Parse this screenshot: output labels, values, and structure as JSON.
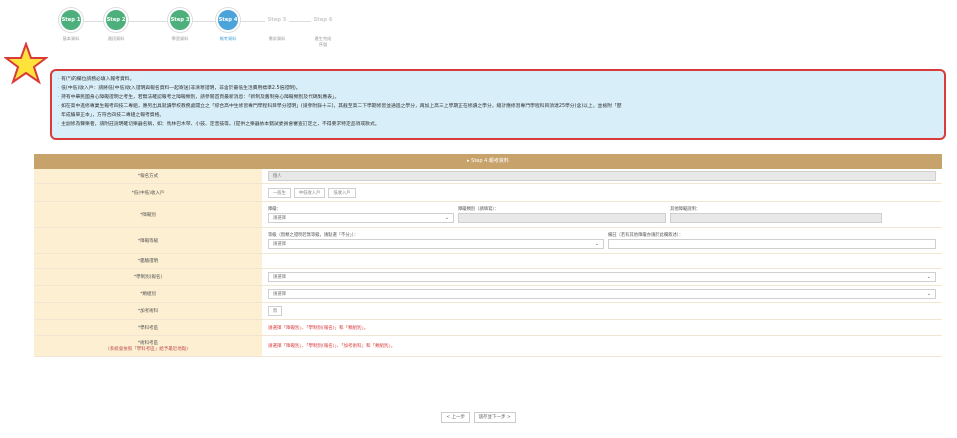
{
  "steps": [
    {
      "circle": "Step 1",
      "label": "基本資料",
      "state": "done"
    },
    {
      "circle": "Step 2",
      "label": "通訊資料",
      "state": "done"
    },
    {
      "circle": "Step 3",
      "label": "學習資料",
      "state": "done"
    },
    {
      "circle": "Step 4",
      "label": "報考資料",
      "state": "current"
    },
    {
      "circle": "Step 5",
      "label": "需求資料",
      "state": "todo"
    },
    {
      "circle": "Step 6",
      "label": "產生完成",
      "label2": "序號",
      "state": "todo"
    }
  ],
  "notice": {
    "lines": [
      "有(*)的欄位請務必填入報考資料。",
      "低(中低)收入戶：請將低(中低)收入證明與報名資料一起寄送(非清寒證明，非含於最低生活費用標準2.5倍證明)。",
      "持有中華民國身心障礙證明之考生，若無法確認報考之障礙類別，請參閱首頁最新消息：「新制及舊制身心障礙類別及代碼對應表」。",
      "如在高中進修專業生報考四技二專組，應另出具就讀學校教務處開立之「綜合高中生修習專門學程科目學分證明」(請參附錄十三)，其截至高二下學期修習並通過之學分，再加上高三上學期正在修讀之學分，總計應修習專門學程科目須達25學分(含)以上，並檢附「歷",
      "年成績單正本」，方符合四技二專組之報考資格。",
      "主副修為聲樂者，請附註說明確切樂器名稱，如：馬林巴木琴、小鼓、定音鼓等。(提供之樂器依本甄試委員會審查訂定之，不得要求特定品項或款式。"
    ]
  },
  "section_title": "▸ Step 4.報考資料",
  "form": {
    "apply_method": {
      "label": "*報名方式",
      "value": "個人"
    },
    "low_income": {
      "label": "*低(中低)收入戶",
      "options": [
        "一般生",
        "中低收入戶",
        "低收入戶"
      ]
    },
    "disability_type": {
      "label": "*障礙別",
      "cap_type": "障礙：",
      "type_placeholder": "請選擇",
      "cap_subtype": "障礙類別（請填寫）：",
      "cap_other": "其他障礙說明："
    },
    "disability_level": {
      "label": "*障礙等級",
      "cap_level": "等級（無類之證明若無等級，請點選「不分」）：",
      "level_placeholder": "請選擇",
      "cap_note": "備註（若有其他障礙亦請於此欄敘述）："
    },
    "disability_note": {
      "label": "*鑑驗證明"
    },
    "dept_group": {
      "label": "*學制別(報名)",
      "placeholder": "請選擇"
    },
    "group_type": {
      "label": "*類組別",
      "placeholder": "請選擇"
    },
    "extra_subject": {
      "label": "*加考術科",
      "value": "無"
    },
    "subject_exam": {
      "label": "*學科考區",
      "hint": "請選擇「障礙別」、「學制別(報名)」和「類組別」。"
    },
    "skill_exam": {
      "label": "*術科考區",
      "sublabel": "(系統會依照「學科考區」給予最近地點)",
      "hint": "請選擇「障礙別」、「學制別(報名)」、「加考術科」和「類組別」。"
    }
  },
  "footer": {
    "prev": "< 上一步",
    "next": "儲存並下一步 >"
  },
  "colors": {
    "section_bar": "#c7a26b",
    "label_bg": "#fcefd2",
    "notice_bg": "#d8eef8",
    "notice_border": "#d93b3b",
    "step_done": "#4caf7c",
    "step_current": "#4aa3d9"
  }
}
